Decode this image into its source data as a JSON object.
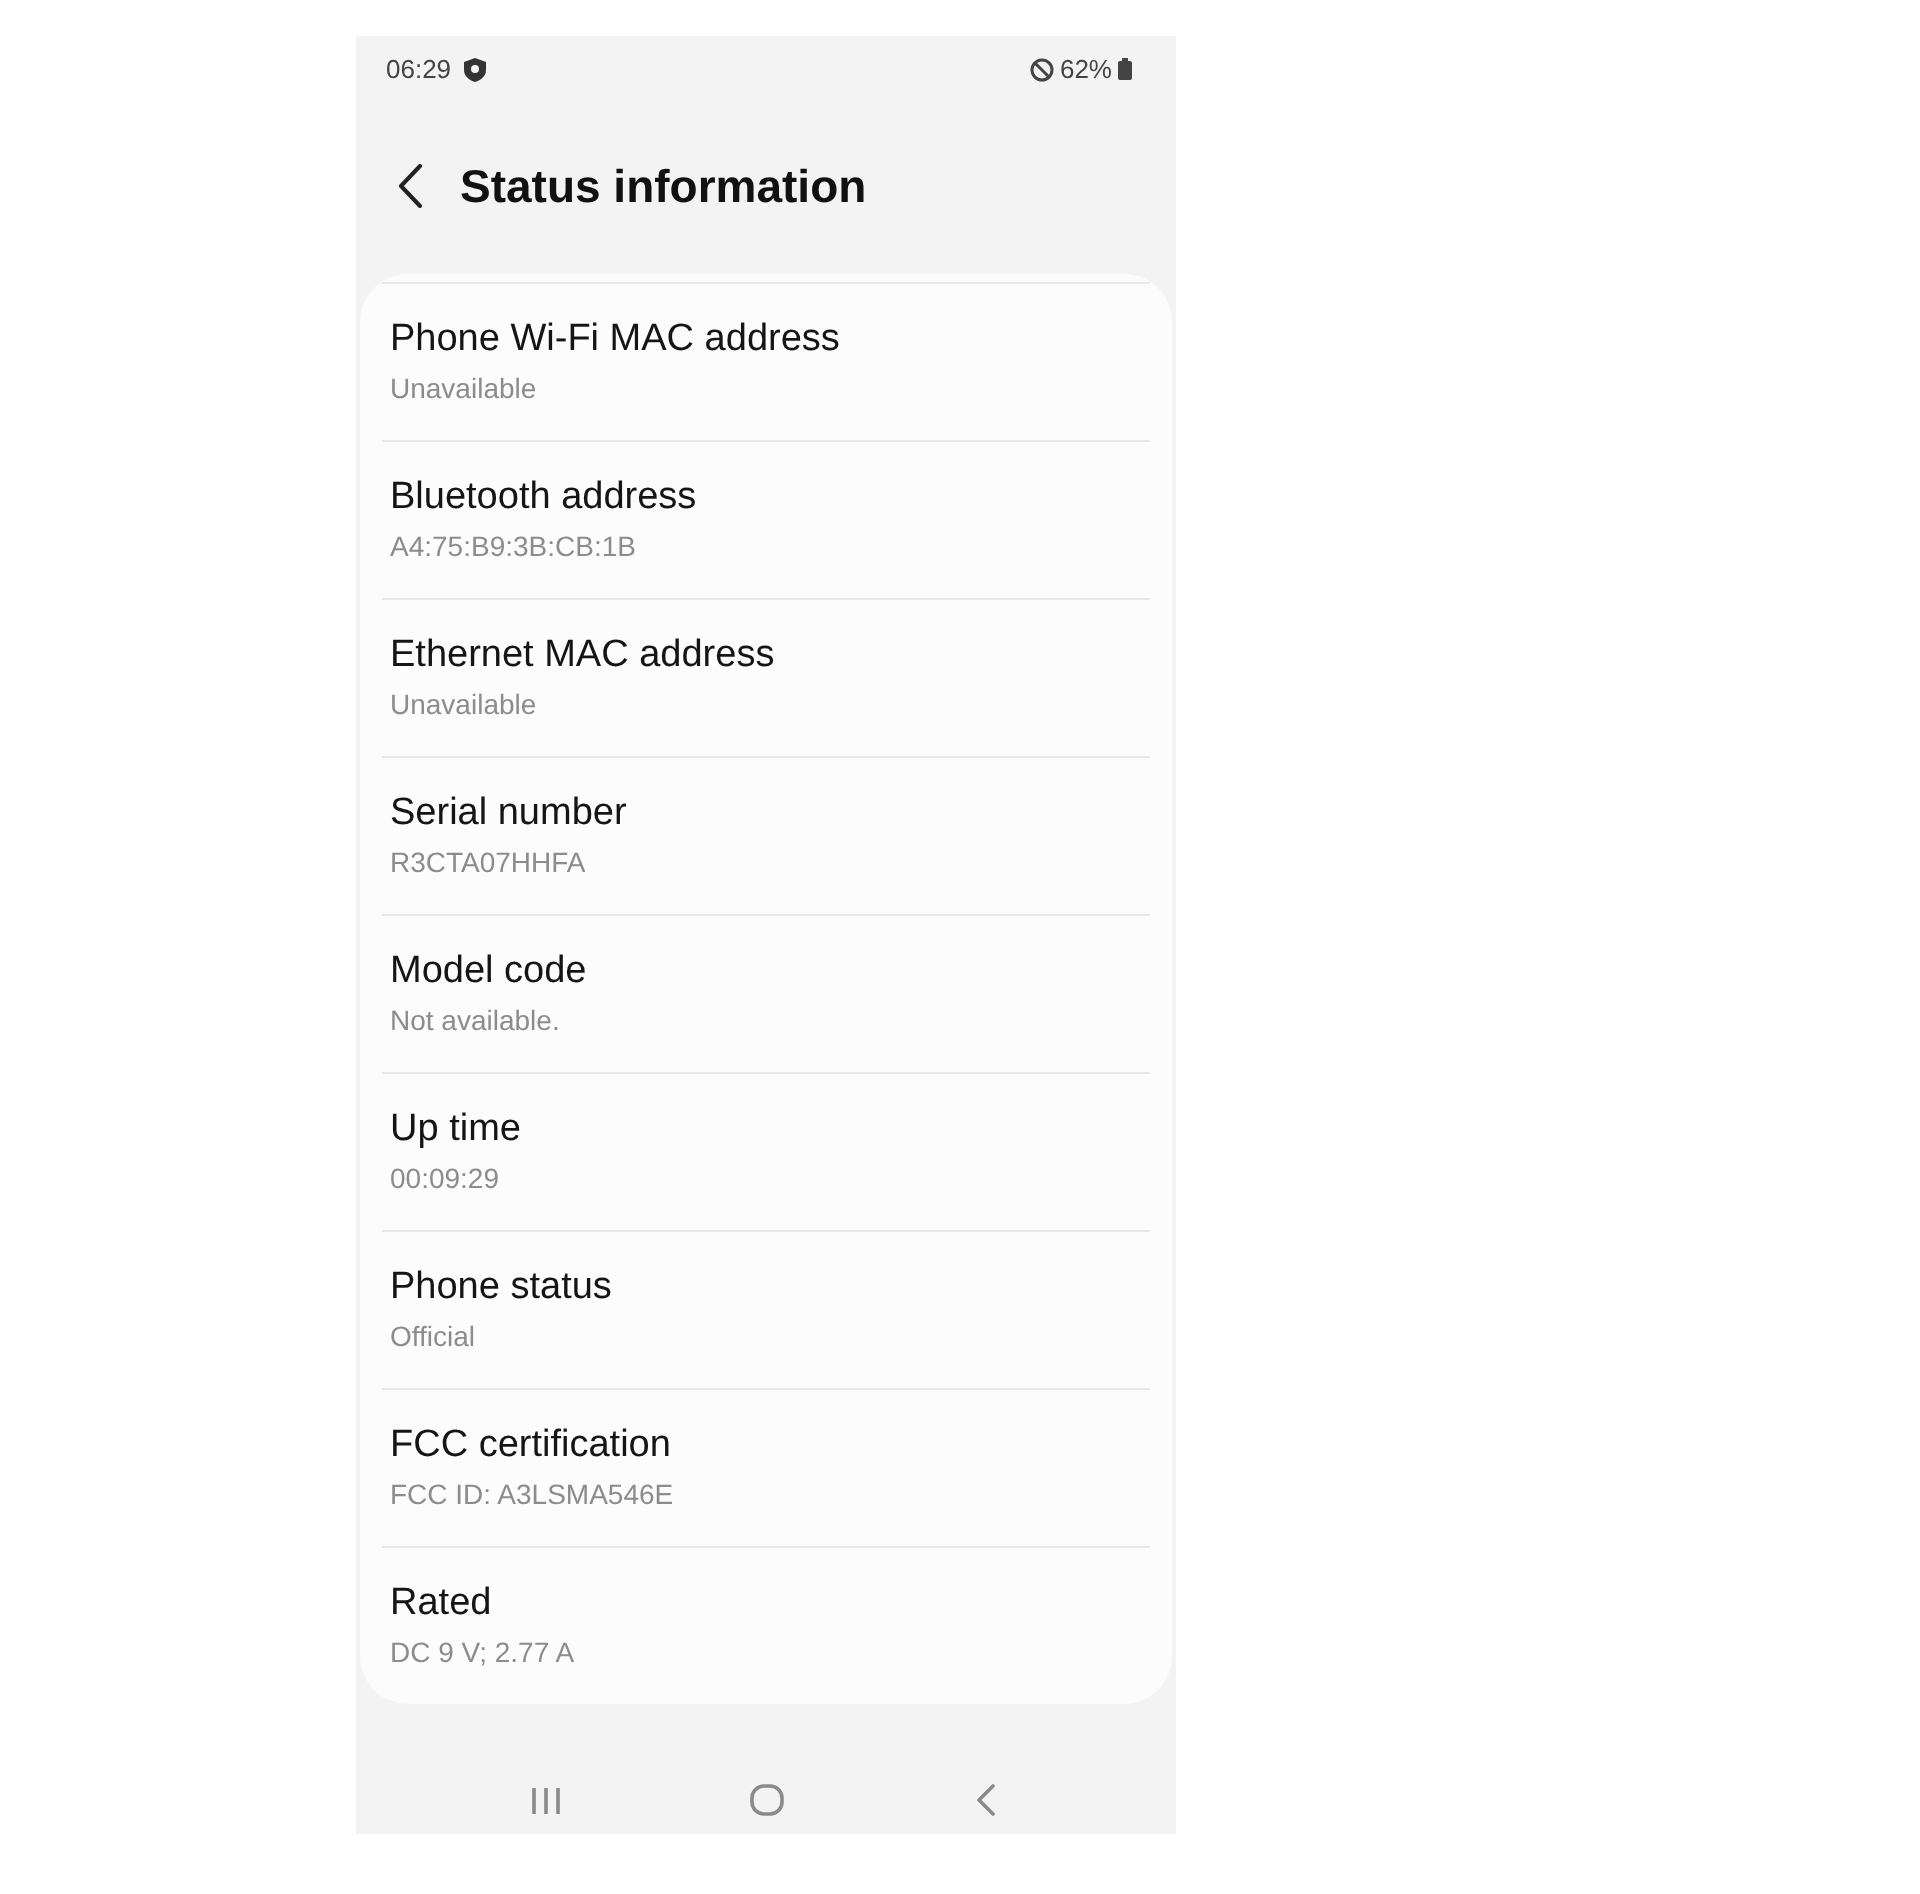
{
  "status_bar": {
    "time": "06:29",
    "battery": "62%"
  },
  "header": {
    "title": "Status information"
  },
  "items": [
    {
      "title": "Phone Wi-Fi MAC address",
      "value": "Unavailable"
    },
    {
      "title": "Bluetooth address",
      "value": "A4:75:B9:3B:CB:1B"
    },
    {
      "title": "Ethernet MAC address",
      "value": "Unavailable"
    },
    {
      "title": "Serial number",
      "value": "R3CTA07HHFA"
    },
    {
      "title": "Model code",
      "value": "Not available."
    },
    {
      "title": "Up time",
      "value": "00:09:29"
    },
    {
      "title": "Phone status",
      "value": "Official"
    },
    {
      "title": "FCC certification",
      "value": "FCC ID: A3LSMA546E"
    },
    {
      "title": "Rated",
      "value": "DC 9 V; 2.77 A"
    }
  ]
}
